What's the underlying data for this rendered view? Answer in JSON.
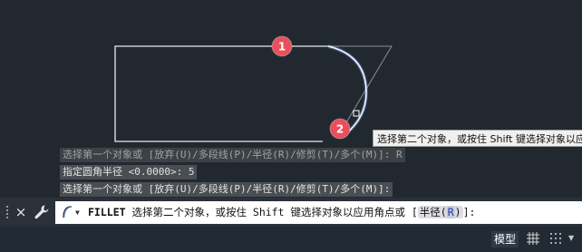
{
  "markers": {
    "first": "1",
    "second": "2"
  },
  "tooltip": "选择第二个对象，或按住 Shift 键选择对象以应用角点或",
  "history": [
    "选择第一个对象或 [放弃(U)/多段线(P)/半径(R)/修剪(T)/多个(M)]: R",
    "指定圆角半径 <0.0000>: 5",
    "选择第一个对象或 [放弃(U)/多段线(P)/半径(R)/修剪(T)/多个(M)]:"
  ],
  "command": {
    "name": "FILLET",
    "prompt": "选择第二个对象，或按住 Shift 键选择对象以应用角点或 [",
    "option_label": "半径(",
    "option_key": "R",
    "option_close": ")",
    "suffix": "]:"
  },
  "icons": {
    "close": "×",
    "wrench": "wrench-icon",
    "command": "command-line-icon",
    "grid": "grid-icon",
    "snap": "snap-dots-icon"
  },
  "statusbar": {
    "model": "模型",
    "menu_caret": "▼"
  },
  "colors": {
    "background": "#212830",
    "marker": "#e8505c",
    "highlight": "#eef6ff",
    "command_bar": "#2b3139"
  }
}
